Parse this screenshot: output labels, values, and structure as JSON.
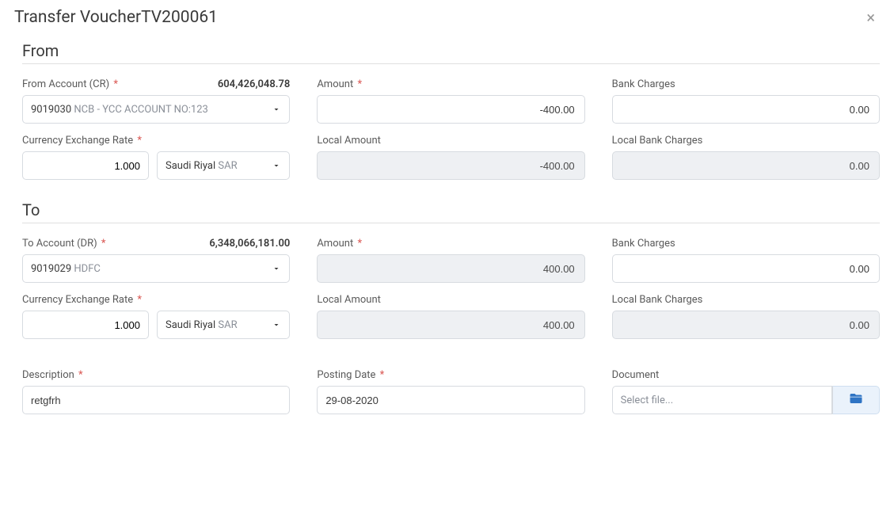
{
  "page": {
    "title": "Transfer VoucherTV200061"
  },
  "from": {
    "heading": "From",
    "accountLabel": "From Account (CR)",
    "balance": "604,426,048.78",
    "accountCode": "9019030",
    "accountName": "NCB - YCC ACCOUNT NO:123",
    "amountLabel": "Amount",
    "amount": "-400.00",
    "bankChargesLabel": "Bank Charges",
    "bankCharges": "0.00",
    "exchangeRateLabel": "Currency Exchange Rate",
    "exchangeRate": "1.000",
    "currencyName": "Saudi Riyal",
    "currencyCode": "SAR",
    "localAmountLabel": "Local Amount",
    "localAmount": "-400.00",
    "localBankChargesLabel": "Local Bank Charges",
    "localBankCharges": "0.00"
  },
  "to": {
    "heading": "To",
    "accountLabel": "To Account (DR)",
    "balance": "6,348,066,181.00",
    "accountCode": "9019029",
    "accountName": "HDFC",
    "amountLabel": "Amount",
    "amount": "400.00",
    "bankChargesLabel": "Bank Charges",
    "bankCharges": "0.00",
    "exchangeRateLabel": "Currency Exchange Rate",
    "exchangeRate": "1.000",
    "currencyName": "Saudi Riyal",
    "currencyCode": "SAR",
    "localAmountLabel": "Local Amount",
    "localAmount": "400.00",
    "localBankChargesLabel": "Local Bank Charges",
    "localBankCharges": "0.00"
  },
  "footer": {
    "descriptionLabel": "Description",
    "description": "retgfrh",
    "postingDateLabel": "Posting Date",
    "postingDate": "29-08-2020",
    "documentLabel": "Document",
    "documentPlaceholder": "Select file..."
  }
}
